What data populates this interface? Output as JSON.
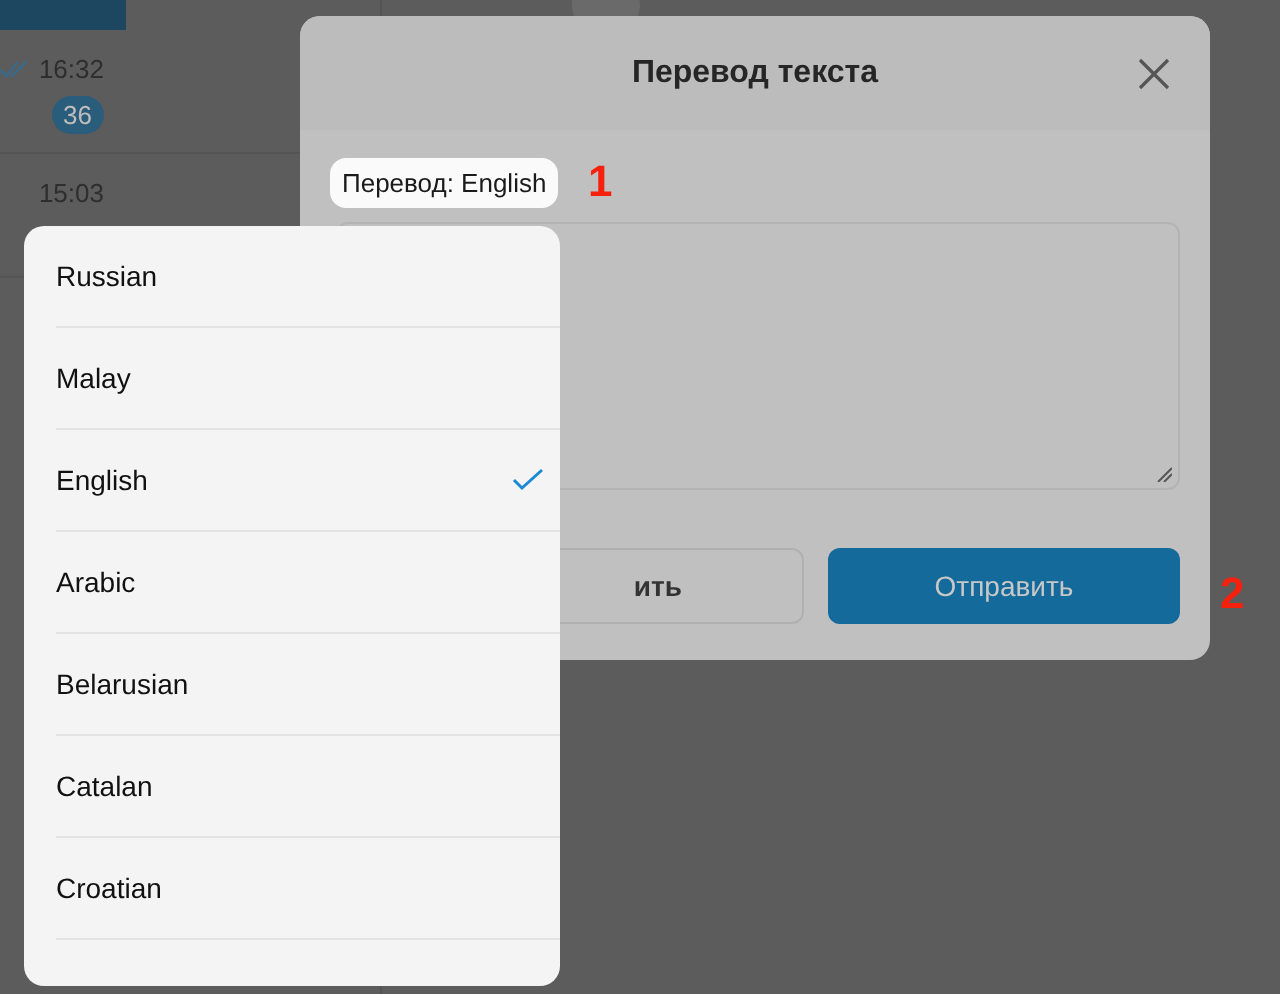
{
  "background": {
    "chat_list": [
      {
        "time": "16:32",
        "badge": "36"
      },
      {
        "time": "15:03"
      }
    ]
  },
  "modal": {
    "title": "Перевод текста",
    "language_chip": "Перевод: English",
    "buttons": [
      {
        "label": "ить",
        "kind": "secondary"
      },
      {
        "label": "Отправить",
        "kind": "primary"
      }
    ]
  },
  "dropdown": {
    "options": [
      {
        "label": "Russian",
        "selected": false
      },
      {
        "label": "Malay",
        "selected": false
      },
      {
        "label": "English",
        "selected": true
      },
      {
        "label": "Arabic",
        "selected": false
      },
      {
        "label": "Belarusian",
        "selected": false
      },
      {
        "label": "Catalan",
        "selected": false
      },
      {
        "label": "Croatian",
        "selected": false
      }
    ]
  },
  "annotations": [
    "1",
    "2"
  ]
}
